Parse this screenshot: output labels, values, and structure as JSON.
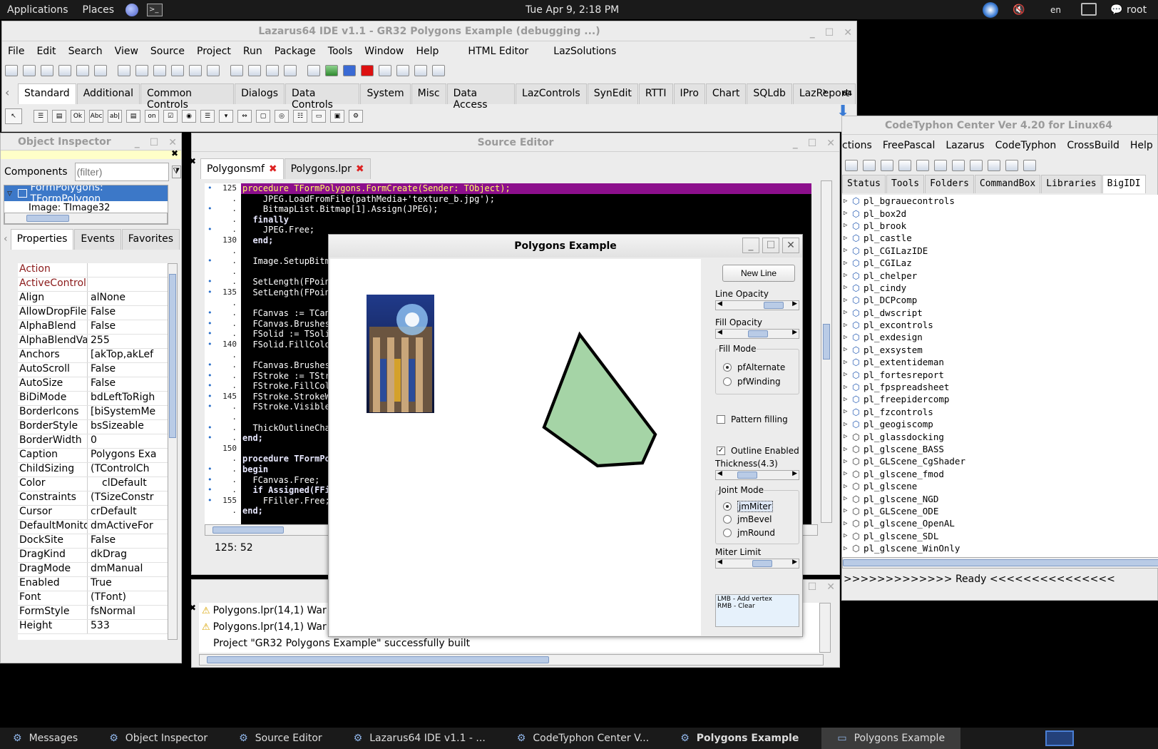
{
  "top_panel": {
    "applications": "Applications",
    "places": "Places",
    "clock": "Tue Apr  9,  2:18 PM",
    "lang": "en",
    "user": "root"
  },
  "ide": {
    "title": "Lazarus64 IDE v1.1 - GR32 Polygons Example (debugging ...)",
    "menu": [
      "File",
      "Edit",
      "Search",
      "View",
      "Source",
      "Project",
      "Run",
      "Package",
      "Tools",
      "Window",
      "Help",
      "HTML Editor",
      "LazSolutions"
    ],
    "palette_tabs": [
      "Standard",
      "Additional",
      "Common Controls",
      "Dialogs",
      "Data Controls",
      "System",
      "Misc",
      "Data Access",
      "LazControls",
      "SynEdit",
      "RTTI",
      "IPro",
      "Chart",
      "SQLdb",
      "LazReport"
    ],
    "arch_label": "64"
  },
  "object_inspector": {
    "title": "Object Inspector",
    "components_label": "Components",
    "filter_placeholder": "(filter)",
    "tree": [
      "FormPolygons: TFormPolygon",
      "Image: TImage32"
    ],
    "tabs": [
      "Properties",
      "Events",
      "Favorites"
    ],
    "properties": [
      {
        "k": "Action",
        "v": "",
        "red": true
      },
      {
        "k": "ActiveControl",
        "v": "",
        "red": true
      },
      {
        "k": "Align",
        "v": "alNone"
      },
      {
        "k": "AllowDropFiles",
        "v": "False"
      },
      {
        "k": "AlphaBlend",
        "v": "False"
      },
      {
        "k": "AlphaBlendValue",
        "v": "255"
      },
      {
        "k": "Anchors",
        "v": "[akTop,akLef",
        "exp": true
      },
      {
        "k": "AutoScroll",
        "v": "False"
      },
      {
        "k": "AutoSize",
        "v": "False"
      },
      {
        "k": "BiDiMode",
        "v": "bdLeftToRigh"
      },
      {
        "k": "BorderIcons",
        "v": "[biSystemMe",
        "exp": true
      },
      {
        "k": "BorderStyle",
        "v": "bsSizeable"
      },
      {
        "k": "BorderWidth",
        "v": "0"
      },
      {
        "k": "Caption",
        "v": "Polygons Exa"
      },
      {
        "k": "ChildSizing",
        "v": "(TControlCh",
        "exp": true
      },
      {
        "k": "Color",
        "v": "clDefault"
      },
      {
        "k": "Constraints",
        "v": "(TSizeConstr",
        "exp": true
      },
      {
        "k": "Cursor",
        "v": "crDefault"
      },
      {
        "k": "DefaultMonitor",
        "v": "dmActiveFor"
      },
      {
        "k": "DockSite",
        "v": "False"
      },
      {
        "k": "DragKind",
        "v": "dkDrag"
      },
      {
        "k": "DragMode",
        "v": "dmManual"
      },
      {
        "k": "Enabled",
        "v": "True"
      },
      {
        "k": "Font",
        "v": "(TFont)",
        "exp": true
      },
      {
        "k": "FormStyle",
        "v": "fsNormal"
      },
      {
        "k": "Height",
        "v": "533"
      }
    ]
  },
  "source_editor": {
    "title": "Source Editor",
    "tabs": [
      "Polygonsmf",
      "Polygons.lpr"
    ],
    "status": "125:  52",
    "line_numbers": [
      "125",
      ".",
      ".",
      ".",
      ".",
      "130",
      ".",
      ".",
      ".",
      ".",
      "135",
      ".",
      ".",
      ".",
      ".",
      "140",
      ".",
      ".",
      ".",
      ".",
      "145",
      ".",
      ".",
      ".",
      ".",
      "150",
      ".",
      ".",
      ".",
      ".",
      "155",
      "."
    ],
    "lines": [
      "procedure TFormPolygons.FormCreate(Sender: TObject);",
      "    JPEG.LoadFromFile(pathMedia+'texture_b.jpg');",
      "    BitmapList.Bitmap[1].Assign(JPEG);",
      "  finally",
      "    JPEG.Free;",
      "  end;",
      "",
      "  Image.SetupBitm",
      "",
      "  SetLength(FPoin",
      "  SetLength(FPoin",
      "",
      "  FCanvas := TCan",
      "  FCanvas.Brushes",
      "  FSolid := TSoli",
      "  FSolid.FillColo",
      "",
      "  FCanvas.Brushes",
      "  FStroke := TStr",
      "  FStroke.FillCol",
      "  FStroke.StrokeW",
      "  FStroke.Visible",
      "",
      "  ThickOutlineCha",
      "end;",
      "",
      "procedure TFormPo",
      "begin",
      "  FCanvas.Free;",
      "  if Assigned(FFi",
      "    FFiller.Free;",
      "end;"
    ]
  },
  "messages": {
    "lines": [
      {
        "text": "Polygons.lpr(14,1) War",
        "warn": true
      },
      {
        "text": "Polygons.lpr(14,1) War",
        "warn": true
      },
      {
        "text": "Project \"GR32 Polygons Example\" successfully built",
        "warn": false
      }
    ]
  },
  "codetyphon": {
    "title": "CodeTyphon Center Ver 4.20 for Linux64",
    "menu": [
      "ctions",
      "FreePascal",
      "Lazarus",
      "CodeTyphon",
      "CrossBuild",
      "Help"
    ],
    "tabs": [
      "Status",
      "Tools",
      "Folders",
      "CommandBox",
      "Libraries",
      "BigIDI"
    ],
    "packages": [
      "pl_bgrauecontrols",
      "pl_box2d",
      "pl_brook",
      "pl_castle",
      "pl_CGILazIDE",
      "pl_CGILaz",
      "pl_chelper",
      "pl_cindy",
      "pl_DCPcomp",
      "pl_dwscript",
      "pl_excontrols",
      "pl_exdesign",
      "pl_exsystem",
      "pl_extentideman",
      "pl_fortesreport",
      "pl_fpspreadsheet",
      "pl_freepidercomp",
      "pl_fzcontrols",
      "pl_geogiscomp",
      "pl_glassdocking",
      "pl_glscene_BASS",
      "pl_GLScene_CgShader",
      "pl_glscene_fmod",
      "pl_glscene",
      "pl_glscene_NGD",
      "pl_GLScene_ODE",
      "pl_glscene_OpenAL",
      "pl_glscene_SDL",
      "pl_glscene_WinOnly"
    ],
    "status": ">>>>>>>>>>>>> Ready <<<<<<<<<<<<<<<"
  },
  "polygons": {
    "title": "Polygons Example",
    "new_line": "New Line",
    "line_opacity": "Line Opacity",
    "line_opacity_level": 0.85,
    "fill_opacity": "Fill Opacity",
    "fill_opacity_level": 0.5,
    "fill_mode": "Fill Mode",
    "fill_modes": [
      "pfAlternate",
      "pfWinding"
    ],
    "fill_mode_selected": 0,
    "pattern_filling": "Pattern filling",
    "pattern_filling_checked": false,
    "outline_enabled": "Outline Enabled",
    "outline_enabled_checked": true,
    "thickness": "Thickness(4.3)",
    "thickness_level": 0.25,
    "joint_mode": "Joint Mode",
    "joint_modes": [
      "jmMiter",
      "jmBevel",
      "jmRound"
    ],
    "joint_mode_selected": 0,
    "miter_limit": "Miter Limit",
    "miter_limit_level": 0.6,
    "hint_lines": [
      "LMB - Add vertex",
      "RMB - Clear"
    ],
    "polygon_fill": "#a5d4a6"
  },
  "taskbar": [
    {
      "label": "Messages",
      "bold": false
    },
    {
      "label": "Object Inspector",
      "bold": false
    },
    {
      "label": "Source Editor",
      "bold": false
    },
    {
      "label": "Lazarus64 IDE v1.1 - ...",
      "bold": false
    },
    {
      "label": "CodeTyphon Center V...",
      "bold": false
    },
    {
      "label": "Polygons Example",
      "bold": true
    },
    {
      "label": "Polygons Example",
      "bold": false,
      "active": true
    }
  ]
}
